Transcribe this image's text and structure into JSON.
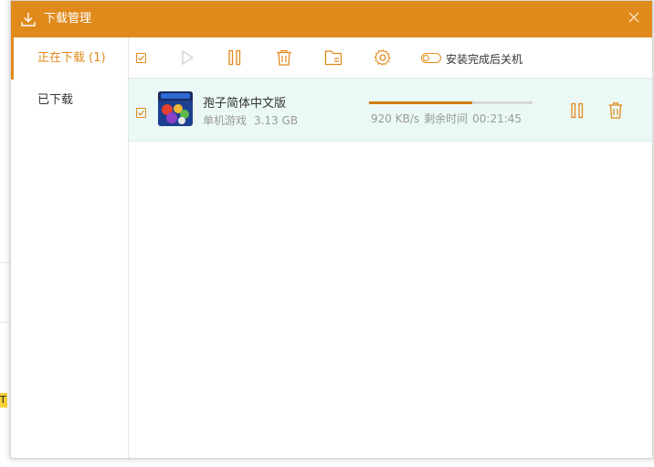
{
  "window": {
    "title": "下载管理"
  },
  "sidebar": {
    "items": [
      {
        "label": "正在下载 (1)",
        "active": true
      },
      {
        "label": "已下载",
        "active": false
      }
    ]
  },
  "toolbar": {
    "select_all_checked": true,
    "buttons": [
      "play-icon",
      "pause-icon",
      "trash-icon",
      "folder-icon",
      "gear-icon"
    ],
    "shutdown_toggle": {
      "label": "安装完成后关机",
      "on": false
    }
  },
  "downloads": [
    {
      "checked": true,
      "name": "孢子简体中文版",
      "category": "单机游戏",
      "size": "3.13 GB",
      "speed": "920 KB/s",
      "remaining_label": "剩余时间",
      "remaining_time": "00:21:45",
      "progress": 0.63
    }
  ],
  "colors": {
    "accent": "#e08a1c",
    "row_bg": "#ebf9f6",
    "progress": "#d57d10"
  }
}
